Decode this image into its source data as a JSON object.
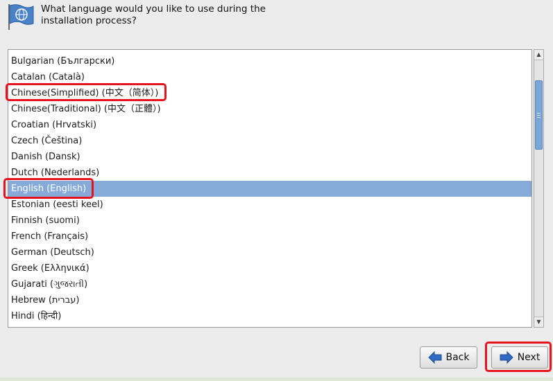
{
  "header": {
    "question": "What language would you like to use during the\ninstallation process?",
    "icon": "language-flag-icon"
  },
  "languages": [
    {
      "label": "Bulgarian (Български)"
    },
    {
      "label": "Catalan (Català)"
    },
    {
      "label": "Chinese(Simplified) (中文（简体）)"
    },
    {
      "label": "Chinese(Traditional) (中文（正體）)"
    },
    {
      "label": "Croatian (Hrvatski)"
    },
    {
      "label": "Czech (Čeština)"
    },
    {
      "label": "Danish (Dansk)"
    },
    {
      "label": "Dutch (Nederlands)"
    },
    {
      "label": "English (English)"
    },
    {
      "label": "Estonian (eesti keel)"
    },
    {
      "label": "Finnish (suomi)"
    },
    {
      "label": "French (Français)"
    },
    {
      "label": "German (Deutsch)"
    },
    {
      "label": "Greek (Ελληνικά)"
    },
    {
      "label": "Gujarati (ગુજરાતી)"
    },
    {
      "label": "Hebrew (עברית)"
    },
    {
      "label": "Hindi (हिन्दी)"
    }
  ],
  "selected_language": "English (English)",
  "highlighted": [
    "Chinese(Simplified) (中文（简体）)",
    "English (English)",
    "Next"
  ],
  "buttons": {
    "back_label": "Back",
    "next_label": "Next",
    "back_icon": "arrow-left-icon",
    "next_icon": "arrow-right-icon"
  },
  "colors": {
    "selection": "#86abd9",
    "highlight_box": "#e8121e",
    "arrow_blue": "#2f6bc4"
  }
}
